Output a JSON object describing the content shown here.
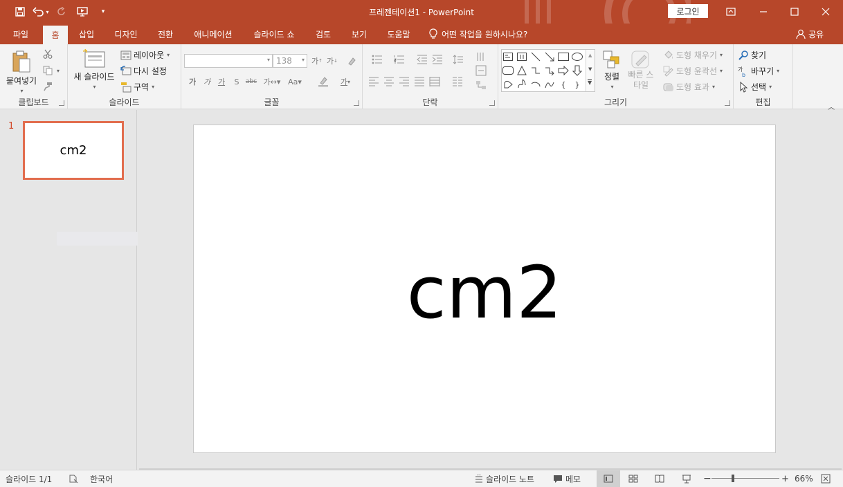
{
  "window": {
    "title": "프레젠테이션1  -  PowerPoint",
    "login_label": "로그인"
  },
  "tabs": [
    "파일",
    "홈",
    "삽입",
    "디자인",
    "전환",
    "애니메이션",
    "슬라이드 쇼",
    "검토",
    "보기",
    "도움말"
  ],
  "active_tab": "홈",
  "tellme": "어떤 작업을 원하시나요?",
  "share": "공유",
  "ribbon": {
    "clipboard": {
      "label": "클립보드",
      "paste": "붙여넣기"
    },
    "slides": {
      "label": "슬라이드",
      "new_slide": "새 슬라이드",
      "layout": "레이아웃",
      "reset": "다시 설정",
      "section": "구역"
    },
    "font": {
      "label": "글꼴",
      "font_name": "",
      "font_size": "138"
    },
    "paragraph": {
      "label": "단락"
    },
    "drawing": {
      "label": "그리기",
      "arrange": "정렬",
      "quick_styles": "빠른 스타일",
      "shape_fill": "도형 채우기",
      "shape_outline": "도형 윤곽선",
      "shape_effects": "도형 효과"
    },
    "editing": {
      "label": "편집",
      "find": "찾기",
      "replace": "바꾸기",
      "select": "선택"
    }
  },
  "thumbnails": [
    {
      "number": "1",
      "text": "cm2"
    }
  ],
  "slide": {
    "text": "cm2"
  },
  "status": {
    "slide_info": "슬라이드 1/1",
    "language": "한국어",
    "notes": "슬라이드 노트",
    "comments": "메모",
    "zoom": "66%"
  },
  "colors": {
    "accent": "#b7472a",
    "ribbon_bg": "#f3f3f3",
    "thumb_border": "#e26d4e"
  },
  "icons": [
    "save-icon",
    "undo-icon",
    "redo-icon",
    "slideshow-icon",
    "lightbulb-icon",
    "person-icon",
    "paste-icon",
    "cut-icon",
    "copy-icon",
    "format-painter-icon",
    "new-slide-icon",
    "layout-icon",
    "reset-icon",
    "section-icon",
    "arrange-icon",
    "quick-styles-icon",
    "find-icon",
    "replace-icon",
    "select-icon",
    "notes-icon",
    "comments-icon",
    "normal-view-icon",
    "slide-sorter-icon",
    "reading-view-icon",
    "slideshow-view-icon",
    "fit-slide-icon"
  ]
}
